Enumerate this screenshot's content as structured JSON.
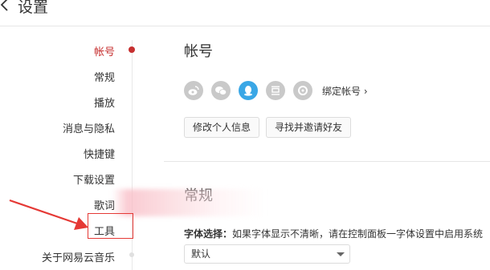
{
  "header": {
    "title": "设置"
  },
  "nav": {
    "items": [
      {
        "label": "帐号",
        "active": true
      },
      {
        "label": "常规"
      },
      {
        "label": "播放"
      },
      {
        "label": "消息与隐私"
      },
      {
        "label": "快捷键"
      },
      {
        "label": "下载设置"
      },
      {
        "label": "歌词"
      },
      {
        "label": "工具"
      },
      {
        "label": "关于网易云音乐"
      }
    ]
  },
  "account": {
    "title": "帐号",
    "social_icons": [
      "weibo-icon",
      "wechat-icon",
      "qq-icon",
      "douban-icon",
      "yixin-icon"
    ],
    "bind_label": "绑定帐号 ›",
    "edit_profile_label": "修改个人信息",
    "invite_friends_label": "寻找并邀请好友"
  },
  "general": {
    "title": "常规",
    "font_label": "字体选择：",
    "font_hint": "如果字体显示不清晰，请在控制面板一字体设置中启用系统",
    "font_value": "默认"
  },
  "colors": {
    "accent": "#c62f2f",
    "qq_active": "#3aa7e6",
    "annotation": "#e53935"
  }
}
